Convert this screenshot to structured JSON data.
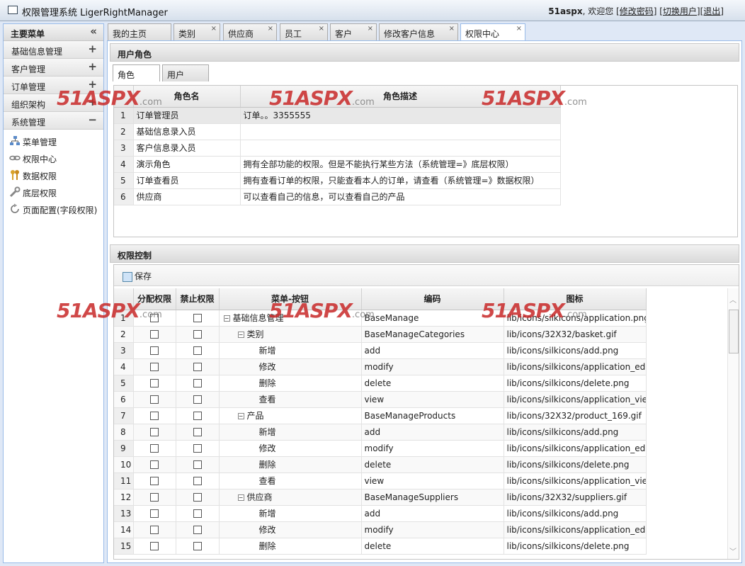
{
  "header": {
    "title": "权限管理系统 LigerRightManager",
    "user": "51aspx",
    "welcome": ", 欢迎您",
    "links": [
      "[修改密码]",
      "[切换用户]",
      "[退出]"
    ]
  },
  "sidebar": {
    "title": "主要菜单",
    "collapse": "«",
    "groups": [
      {
        "label": "基础信息管理",
        "sign": "+"
      },
      {
        "label": "客户管理",
        "sign": "+"
      },
      {
        "label": "订单管理",
        "sign": "+"
      },
      {
        "label": "组织架构",
        "sign": "+"
      },
      {
        "label": "系统管理",
        "sign": "−"
      }
    ],
    "items": [
      {
        "label": "菜单管理",
        "icon": "sitemap-icon"
      },
      {
        "label": "权限中心",
        "icon": "link-icon"
      },
      {
        "label": "数据权限",
        "icon": "keys-icon"
      },
      {
        "label": "底层权限",
        "icon": "wrench-icon"
      },
      {
        "label": "页面配置(字段权限)",
        "icon": "refresh-icon"
      }
    ]
  },
  "tabs": [
    {
      "label": "我的主页",
      "close": ""
    },
    {
      "label": "类别",
      "close": "×"
    },
    {
      "label": "供应商",
      "close": "×"
    },
    {
      "label": "员工",
      "close": "×"
    },
    {
      "label": "客户",
      "close": "×"
    },
    {
      "label": "修改客户信息",
      "close": "×"
    },
    {
      "label": "权限中心",
      "close": "×"
    }
  ],
  "roles_panel": {
    "title": "用户角色",
    "subtabs": [
      "角色",
      "用户"
    ],
    "columns": [
      "",
      "角色名",
      "角色描述"
    ],
    "rows": [
      {
        "n": "1",
        "name": "订单管理员",
        "desc": "订单。。3355555"
      },
      {
        "n": "2",
        "name": "基础信息录入员",
        "desc": ""
      },
      {
        "n": "3",
        "name": "客户信息录入员",
        "desc": ""
      },
      {
        "n": "4",
        "name": "演示角色",
        "desc": "拥有全部功能的权限。但是不能执行某些方法（系统管理=》底层权限）"
      },
      {
        "n": "5",
        "name": "订单查看员",
        "desc": "拥有查看订单的权限，只能查看本人的订单，请查看（系统管理=》数据权限）"
      },
      {
        "n": "6",
        "name": "供应商",
        "desc": "可以查看自己的信息，可以查看自己的产品"
      }
    ]
  },
  "perm_panel": {
    "title": "权限控制",
    "save_label": "保存",
    "columns": [
      "",
      "分配权限",
      "禁止权限",
      "菜单-按钮",
      "编码",
      "图标"
    ],
    "rows": [
      {
        "n": "1",
        "level": 0,
        "toggle": "−",
        "menu": "基础信息管理",
        "code": "BaseManage",
        "icon": "lib/icons/silkicons/application.png"
      },
      {
        "n": "2",
        "level": 1,
        "toggle": "−",
        "menu": "类别",
        "code": "BaseManageCategories",
        "icon": "lib/icons/32X32/basket.gif"
      },
      {
        "n": "3",
        "level": 2,
        "toggle": "",
        "menu": "新增",
        "code": "add",
        "icon": "lib/icons/silkicons/add.png"
      },
      {
        "n": "4",
        "level": 2,
        "toggle": "",
        "menu": "修改",
        "code": "modify",
        "icon": "lib/icons/silkicons/application_edit.png"
      },
      {
        "n": "5",
        "level": 2,
        "toggle": "",
        "menu": "删除",
        "code": "delete",
        "icon": "lib/icons/silkicons/delete.png"
      },
      {
        "n": "6",
        "level": 2,
        "toggle": "",
        "menu": "查看",
        "code": "view",
        "icon": "lib/icons/silkicons/application_view_list.png"
      },
      {
        "n": "7",
        "level": 1,
        "toggle": "−",
        "menu": "产品",
        "code": "BaseManageProducts",
        "icon": "lib/icons/32X32/product_169.gif"
      },
      {
        "n": "8",
        "level": 2,
        "toggle": "",
        "menu": "新增",
        "code": "add",
        "icon": "lib/icons/silkicons/add.png"
      },
      {
        "n": "9",
        "level": 2,
        "toggle": "",
        "menu": "修改",
        "code": "modify",
        "icon": "lib/icons/silkicons/application_edit.png"
      },
      {
        "n": "10",
        "level": 2,
        "toggle": "",
        "menu": "删除",
        "code": "delete",
        "icon": "lib/icons/silkicons/delete.png"
      },
      {
        "n": "11",
        "level": 2,
        "toggle": "",
        "menu": "查看",
        "code": "view",
        "icon": "lib/icons/silkicons/application_view_list.png"
      },
      {
        "n": "12",
        "level": 1,
        "toggle": "−",
        "menu": "供应商",
        "code": "BaseManageSuppliers",
        "icon": "lib/icons/32X32/suppliers.gif"
      },
      {
        "n": "13",
        "level": 2,
        "toggle": "",
        "menu": "新增",
        "code": "add",
        "icon": "lib/icons/silkicons/add.png"
      },
      {
        "n": "14",
        "level": 2,
        "toggle": "",
        "menu": "修改",
        "code": "modify",
        "icon": "lib/icons/silkicons/application_edit.png"
      },
      {
        "n": "15",
        "level": 2,
        "toggle": "",
        "menu": "删除",
        "code": "delete",
        "icon": "lib/icons/silkicons/delete.png"
      }
    ]
  },
  "watermark": {
    "brand": "51ASPX",
    "suffix": ".com"
  }
}
